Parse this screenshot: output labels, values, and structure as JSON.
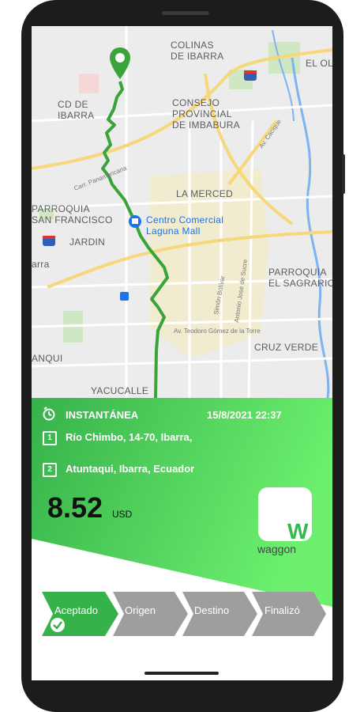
{
  "map": {
    "labels": [
      {
        "text": "COLINAS\nDE IBARRA",
        "kind": "area"
      },
      {
        "text": "EL OL",
        "kind": "area"
      },
      {
        "text": "CD DE\nIBARRA",
        "kind": "area"
      },
      {
        "text": "CONSEJO\nPROVINCIAL\nDE IMBABURA",
        "kind": "area"
      },
      {
        "text": "LA MERCED",
        "kind": "area"
      },
      {
        "text": "PARROQUIA\nSAN FRANCISCO",
        "kind": "area"
      },
      {
        "text": "Centro Comercial\nLaguna Mall",
        "kind": "poi"
      },
      {
        "text": "JARDIN",
        "kind": "area"
      },
      {
        "text": "arra",
        "kind": "area"
      },
      {
        "text": "PARROQUIA\nEL SAGRARIO",
        "kind": "area"
      },
      {
        "text": "CRUZ VERDE",
        "kind": "area"
      },
      {
        "text": "ANQUI",
        "kind": "area"
      },
      {
        "text": "YACUCALLE",
        "kind": "area"
      }
    ],
    "street_labels": [
      "Carr. Panamericana",
      "Av. Teodoro Gómez de la Torre",
      "Simón Bolívar",
      "Antonio José de Sucre",
      "Av. Cacique"
    ],
    "highway_shield": "35",
    "route_color": "#3aa33a"
  },
  "ride": {
    "type": "INSTANTÁNEA",
    "datetime": "15/8/2021 22:37",
    "stop1_num": "1",
    "origin": "Río Chimbo, 14-70, Ibarra,",
    "stop2_num": "2",
    "destination": "Atuntaqui, Ibarra, Ecuador",
    "price": "8.52",
    "currency": "USD"
  },
  "brand": {
    "logo_letter": "W",
    "name": "waggon"
  },
  "steps": [
    {
      "label": "Aceptado",
      "state": "done"
    },
    {
      "label": "Origen",
      "state": "pending"
    },
    {
      "label": "Destino",
      "state": "pending"
    },
    {
      "label": "Finalizó",
      "state": "pending"
    }
  ],
  "colors": {
    "accent": "#4cd964",
    "accent_dark": "#36b24a",
    "step_inactive": "#9e9e9e"
  }
}
